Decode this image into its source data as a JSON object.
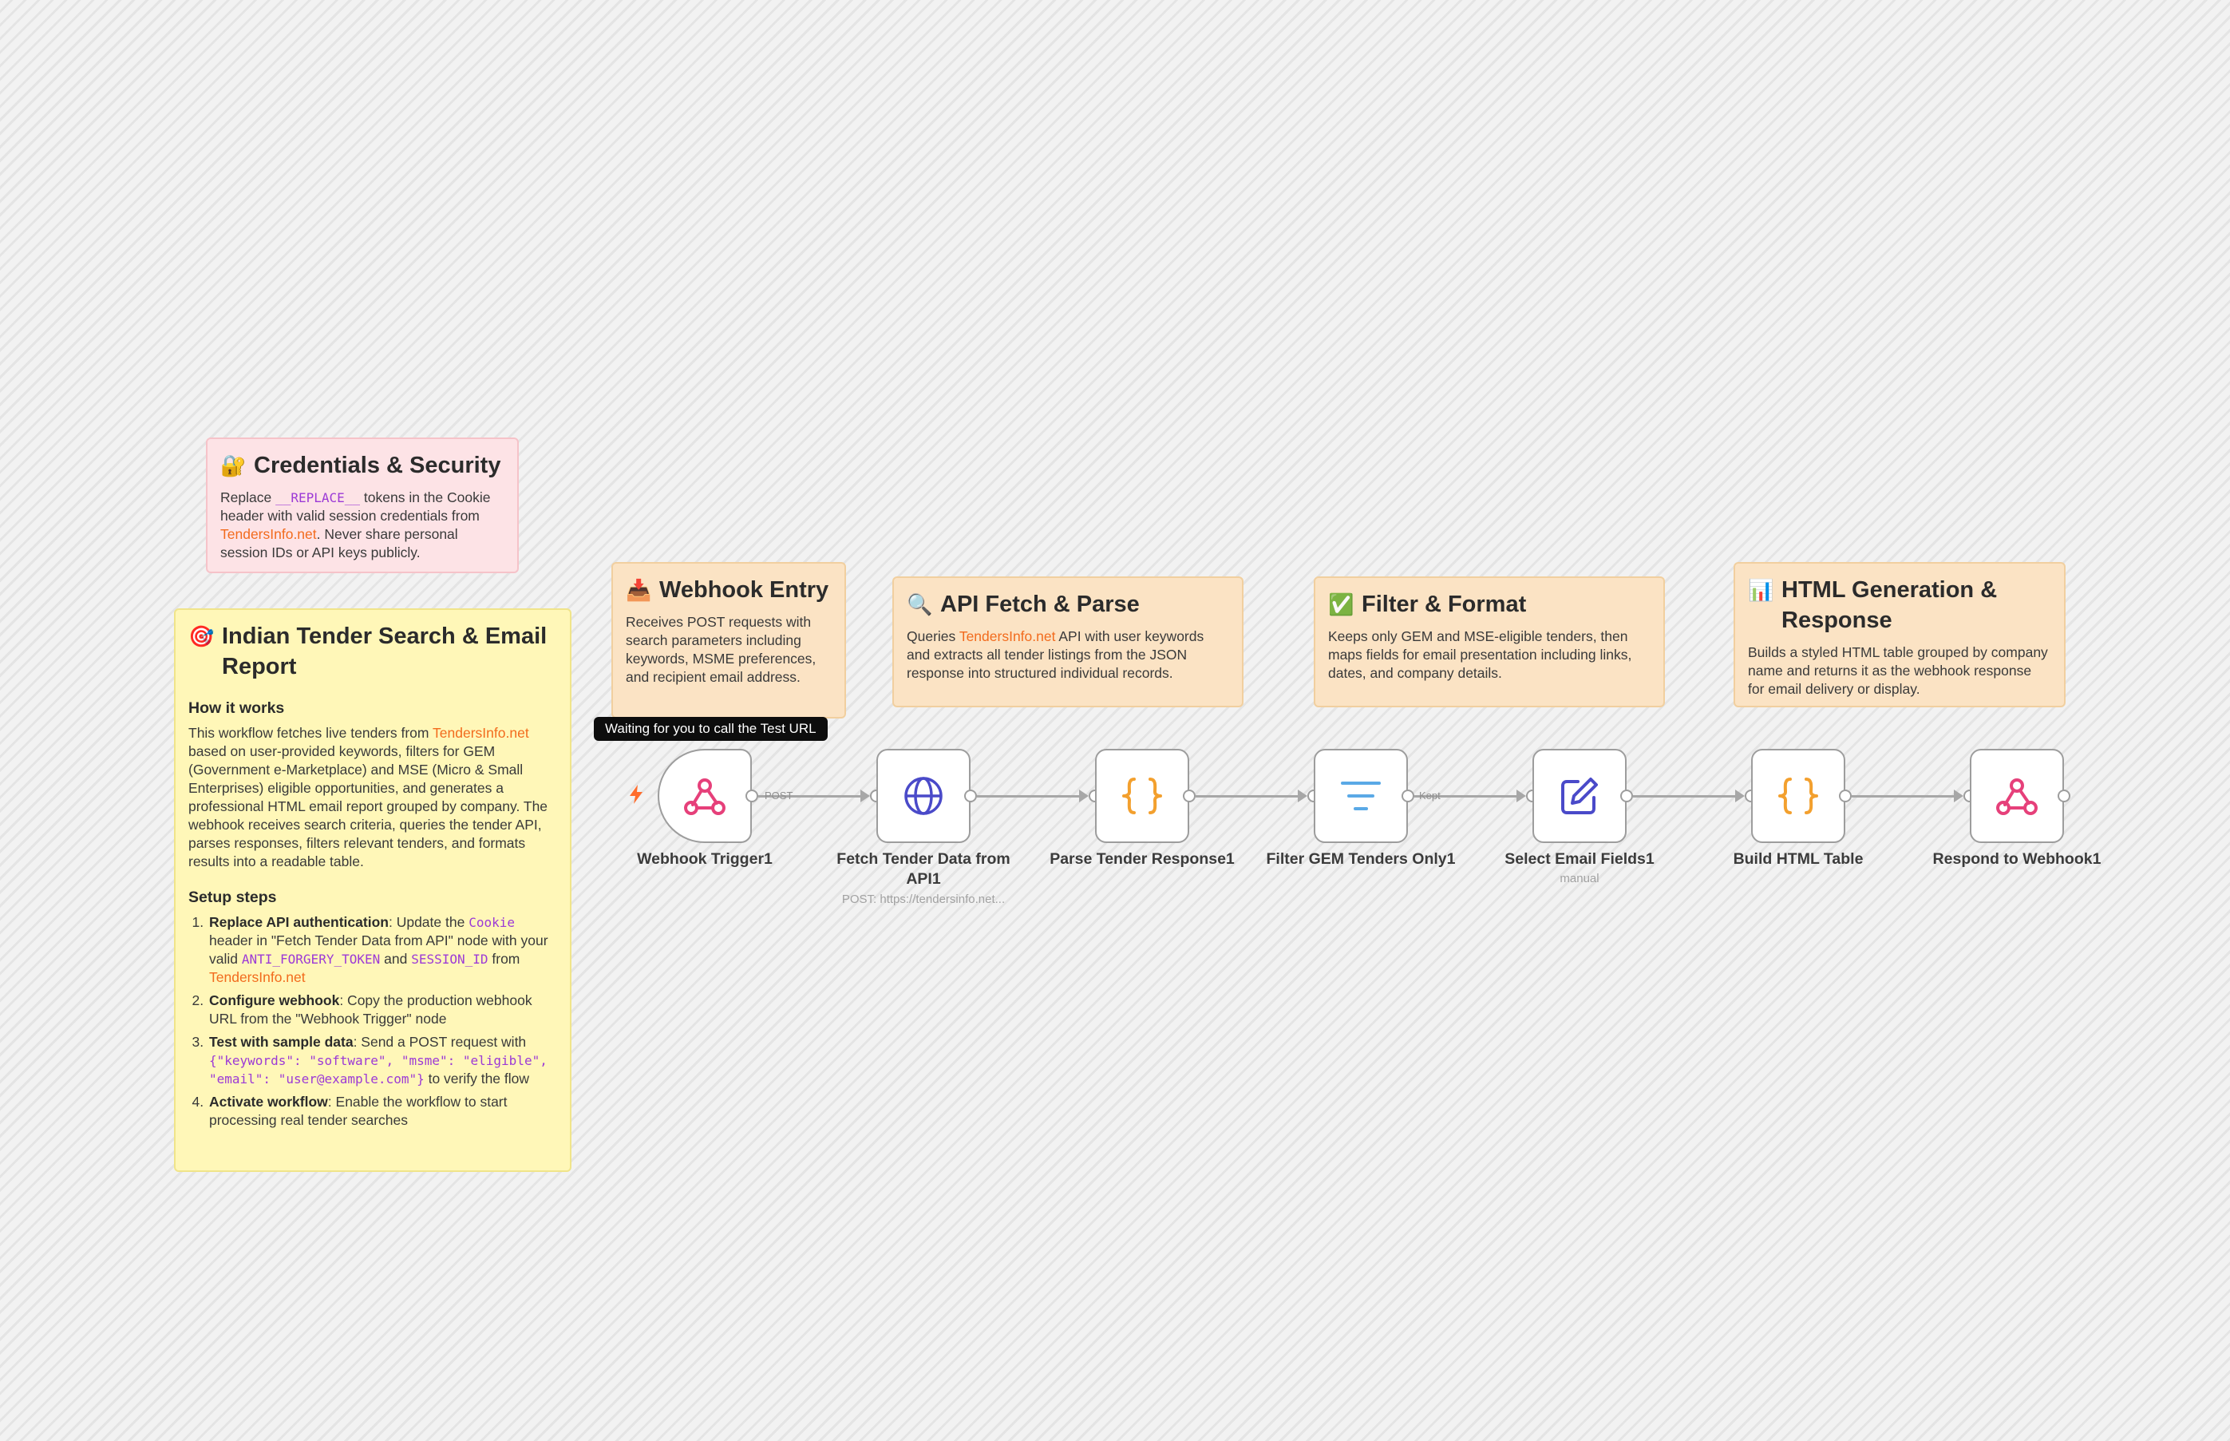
{
  "notes": {
    "credentials": {
      "emoji": "🔐",
      "title": "Credentials & Security",
      "body": {
        "t1": "Replace ",
        "code": "__REPLACE__",
        "t2": " tokens in the Cookie header with valid session credentials from ",
        "link": "TendersInfo.net",
        "t3": ". Never share personal session IDs or API keys publicly."
      }
    },
    "webhook_entry": {
      "emoji": "📥",
      "title": "Webhook Entry",
      "body": "Receives POST requests with search parameters including keywords, MSME preferences, and recipient email address."
    },
    "api_fetch": {
      "emoji": "🔍",
      "title": "API Fetch & Parse",
      "body": {
        "t1": "Queries ",
        "link": "TendersInfo.net",
        "t2": " API with user keywords and extracts all tender listings from the JSON response into structured individual records."
      }
    },
    "filter_format": {
      "emoji": "✅",
      "title": "Filter & Format",
      "body": "Keeps only GEM and MSE-eligible tenders, then maps fields for email presentation including links, dates, and company details."
    },
    "html_gen": {
      "emoji": "📊",
      "title": "HTML Generation & Response",
      "body": "Builds a styled HTML table grouped by company name and returns it as the webhook response for email delivery or display."
    },
    "main": {
      "emoji": "🎯",
      "title": "Indian Tender Search & Email Report",
      "how_heading": "How it works",
      "how": {
        "t1": "This workflow fetches live tenders from ",
        "link": "TendersInfo.net",
        "t2": " based on user-provided keywords, filters for GEM (Government e-Marketplace) and MSE (Micro & Small Enterprises) eligible opportunities, and generates a professional HTML email report grouped by company. The webhook receives search criteria, queries the tender API, parses responses, filters relevant tenders, and formats results into a readable table."
      },
      "setup_heading": "Setup steps",
      "steps": [
        {
          "bold": "Replace API authentication",
          "t1": ": Update the ",
          "code1": "Cookie",
          "t2": " header in \"Fetch Tender Data from API\" node with your valid ",
          "code2": "ANTI_FORGERY_TOKEN",
          "t3": " and ",
          "code3": "SESSION_ID",
          "t4": " from ",
          "link": "TendersInfo.net"
        },
        {
          "bold": "Configure webhook",
          "t1": ": Copy the production webhook URL from the \"Webhook Trigger\" node"
        },
        {
          "bold": "Test with sample data",
          "t1": ": Send a POST request with ",
          "code1": "{\"keywords\": \"software\", \"msme\": \"eligible\", \"email\": \"user@example.com\"}",
          "t2": " to verify the flow"
        },
        {
          "bold": "Activate workflow",
          "t1": ": Enable the workflow to start processing real tender searches"
        }
      ]
    }
  },
  "tooltip": "Waiting for you to call the Test URL",
  "nodes": [
    {
      "label": "Webhook Trigger1",
      "icon": "webhook-icon",
      "color": "#e6407a"
    },
    {
      "label": "Fetch Tender Data from API1",
      "sub": "POST: https://tendersinfo.net...",
      "icon": "globe-icon",
      "color": "#4a4ac9"
    },
    {
      "label": "Parse Tender Response1",
      "icon": "code-braces-icon",
      "color": "#f3a02e"
    },
    {
      "label": "Filter GEM Tenders Only1",
      "icon": "filter-icon",
      "color": "#5aa9e6"
    },
    {
      "label": "Select Email Fields1",
      "sub": "manual",
      "icon": "edit-icon",
      "color": "#4a4ac9"
    },
    {
      "label": "Build HTML Table",
      "icon": "code-braces-icon",
      "color": "#f3a02e"
    },
    {
      "label": "Respond to Webhook1",
      "icon": "webhook-icon",
      "color": "#e6407a"
    }
  ],
  "edge_labels": {
    "post": "POST",
    "kept": "Kept"
  }
}
